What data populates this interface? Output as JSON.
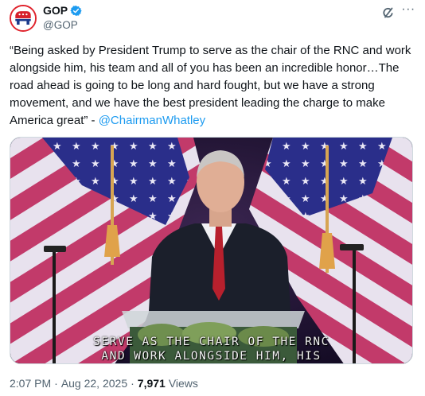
{
  "account": {
    "display_name": "GOP",
    "handle": "@GOP",
    "verified": true,
    "avatar_icon": "republican-elephant-icon"
  },
  "actions": {
    "grok_icon": "grok-icon",
    "more_icon": "more-dots-icon",
    "more_glyph": "···"
  },
  "tweet": {
    "text": "“Being asked by President Trump to serve as the chair of the RNC and work alongside him, his team and all of you has been an incredible honor…The road ahead is going to be long and hard fought, but we have a strong movement, and we have the best president leading the charge to make America great” - ",
    "mention": "@ChairmanWhatley"
  },
  "video": {
    "caption_line1": "SERVE AS THE CHAIR OF THE RNC",
    "caption_line2": "AND WORK ALONGSIDE HIM, HIS"
  },
  "meta": {
    "time": "2:07 PM",
    "separator": "·",
    "date": "Aug 22, 2025",
    "views_count": "7,971",
    "views_label": "Views"
  },
  "colors": {
    "accent": "#1d9bf0",
    "verified": "#1d9bf0",
    "gop_red": "#e0232c"
  }
}
